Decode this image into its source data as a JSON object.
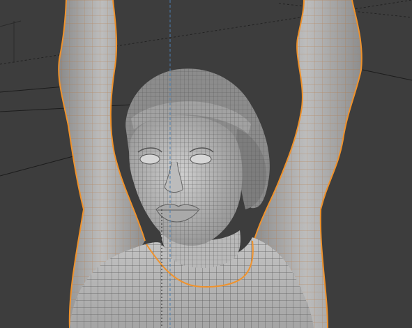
{
  "viewport": {
    "background": "#3d3d3d",
    "selection_outline_color": "#f0922b",
    "wire_color": "#d8893a",
    "mesh_base_color": "#9b9b9b",
    "mesh_light_color": "#c9c9c9",
    "mesh_dark_color": "#6b6b6b",
    "grid_line_color": "#1c1c1c",
    "vertical_axis_color": "#4a7fb2",
    "view_mode": "solid-with-wireframe-overlay",
    "selection_state": "arms-and-torso-selected"
  }
}
